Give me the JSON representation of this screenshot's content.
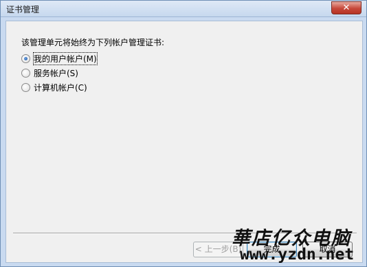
{
  "window": {
    "title": "证书管理",
    "close_glyph": "✕"
  },
  "main": {
    "prompt": "该管理单元将始终为下列帐户管理证书:",
    "options": [
      {
        "label": "我的用户帐户(M)",
        "selected": true
      },
      {
        "label": "服务帐户(S)",
        "selected": false
      },
      {
        "label": "计算机帐户(C)",
        "selected": false
      }
    ]
  },
  "footer": {
    "back_label": "< 上一步(B)",
    "finish_label": "完成",
    "cancel_label": "取消"
  },
  "watermark": {
    "brand_cn": "華店亿众电脑",
    "url": "www.yzdn.net"
  }
}
